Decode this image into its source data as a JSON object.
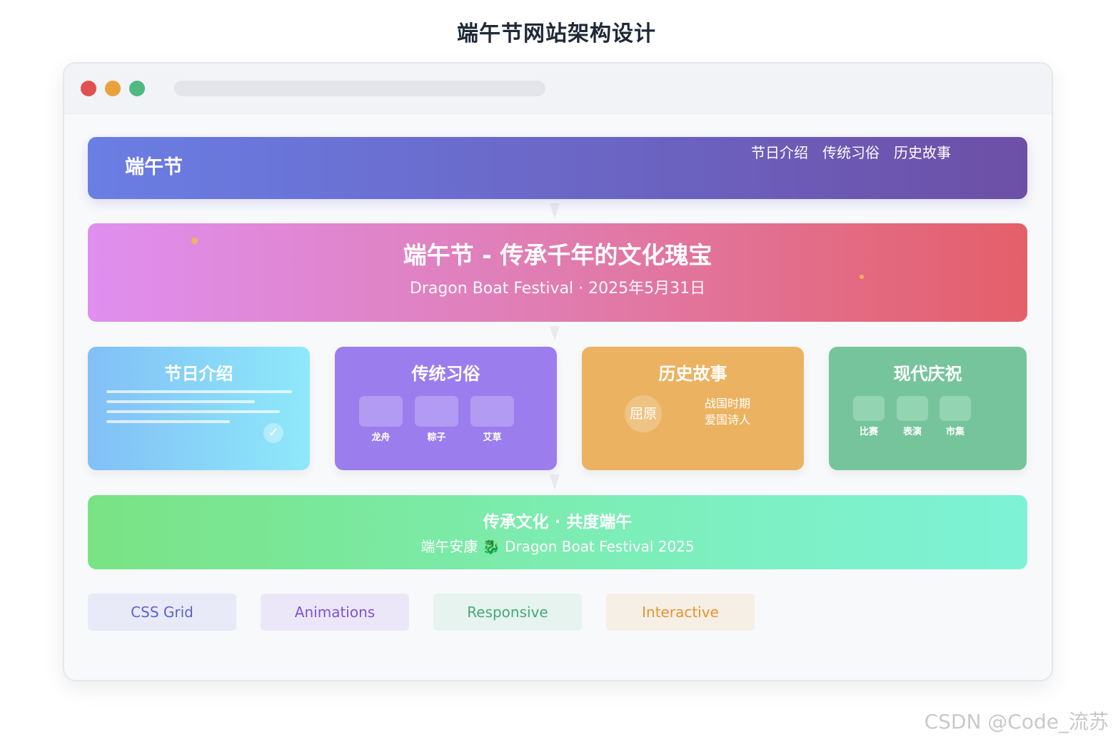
{
  "page": {
    "title": "端午节网站架构设计"
  },
  "colors": {
    "header_gradient": [
      "#6a7ee4",
      "#6d4fa6"
    ],
    "hero_gradient": [
      "#e08ff0",
      "#e45f6a"
    ],
    "card_intro": "#82bff6",
    "card_customs": "#9b7ded",
    "card_history": "#ebb361",
    "card_modern": "#76c49b",
    "footer_gradient": [
      "#79e384",
      "#7df2d6"
    ]
  },
  "browser": {
    "controls": [
      "close-dot",
      "minimize-dot",
      "maximize-dot"
    ]
  },
  "header": {
    "logo": "端午节",
    "nav": [
      "节日介绍",
      "传统习俗",
      "历史故事"
    ]
  },
  "hero": {
    "title": "端午节 - 传承千年的文化瑰宝",
    "subtitle": "Dragon Boat Festival · 2025年5月31日"
  },
  "cards": {
    "intro": {
      "title": "节日介绍",
      "icon": "check-icon"
    },
    "customs": {
      "title": "传统习俗",
      "items": [
        "龙舟",
        "粽子",
        "艾草"
      ]
    },
    "history": {
      "title": "历史故事",
      "badge": "屈原",
      "desc_line1": "战国时期",
      "desc_line2": "爱国诗人"
    },
    "modern": {
      "title": "现代庆祝",
      "items": [
        "比赛",
        "表演",
        "市集"
      ]
    }
  },
  "footer": {
    "title": "传承文化 · 共度端午",
    "subtitle": "端午安康 🐉 Dragon Boat Festival 2025"
  },
  "tags": [
    "CSS Grid",
    "Animations",
    "Responsive",
    "Interactive"
  ],
  "watermark": "CSDN @Code_流苏"
}
